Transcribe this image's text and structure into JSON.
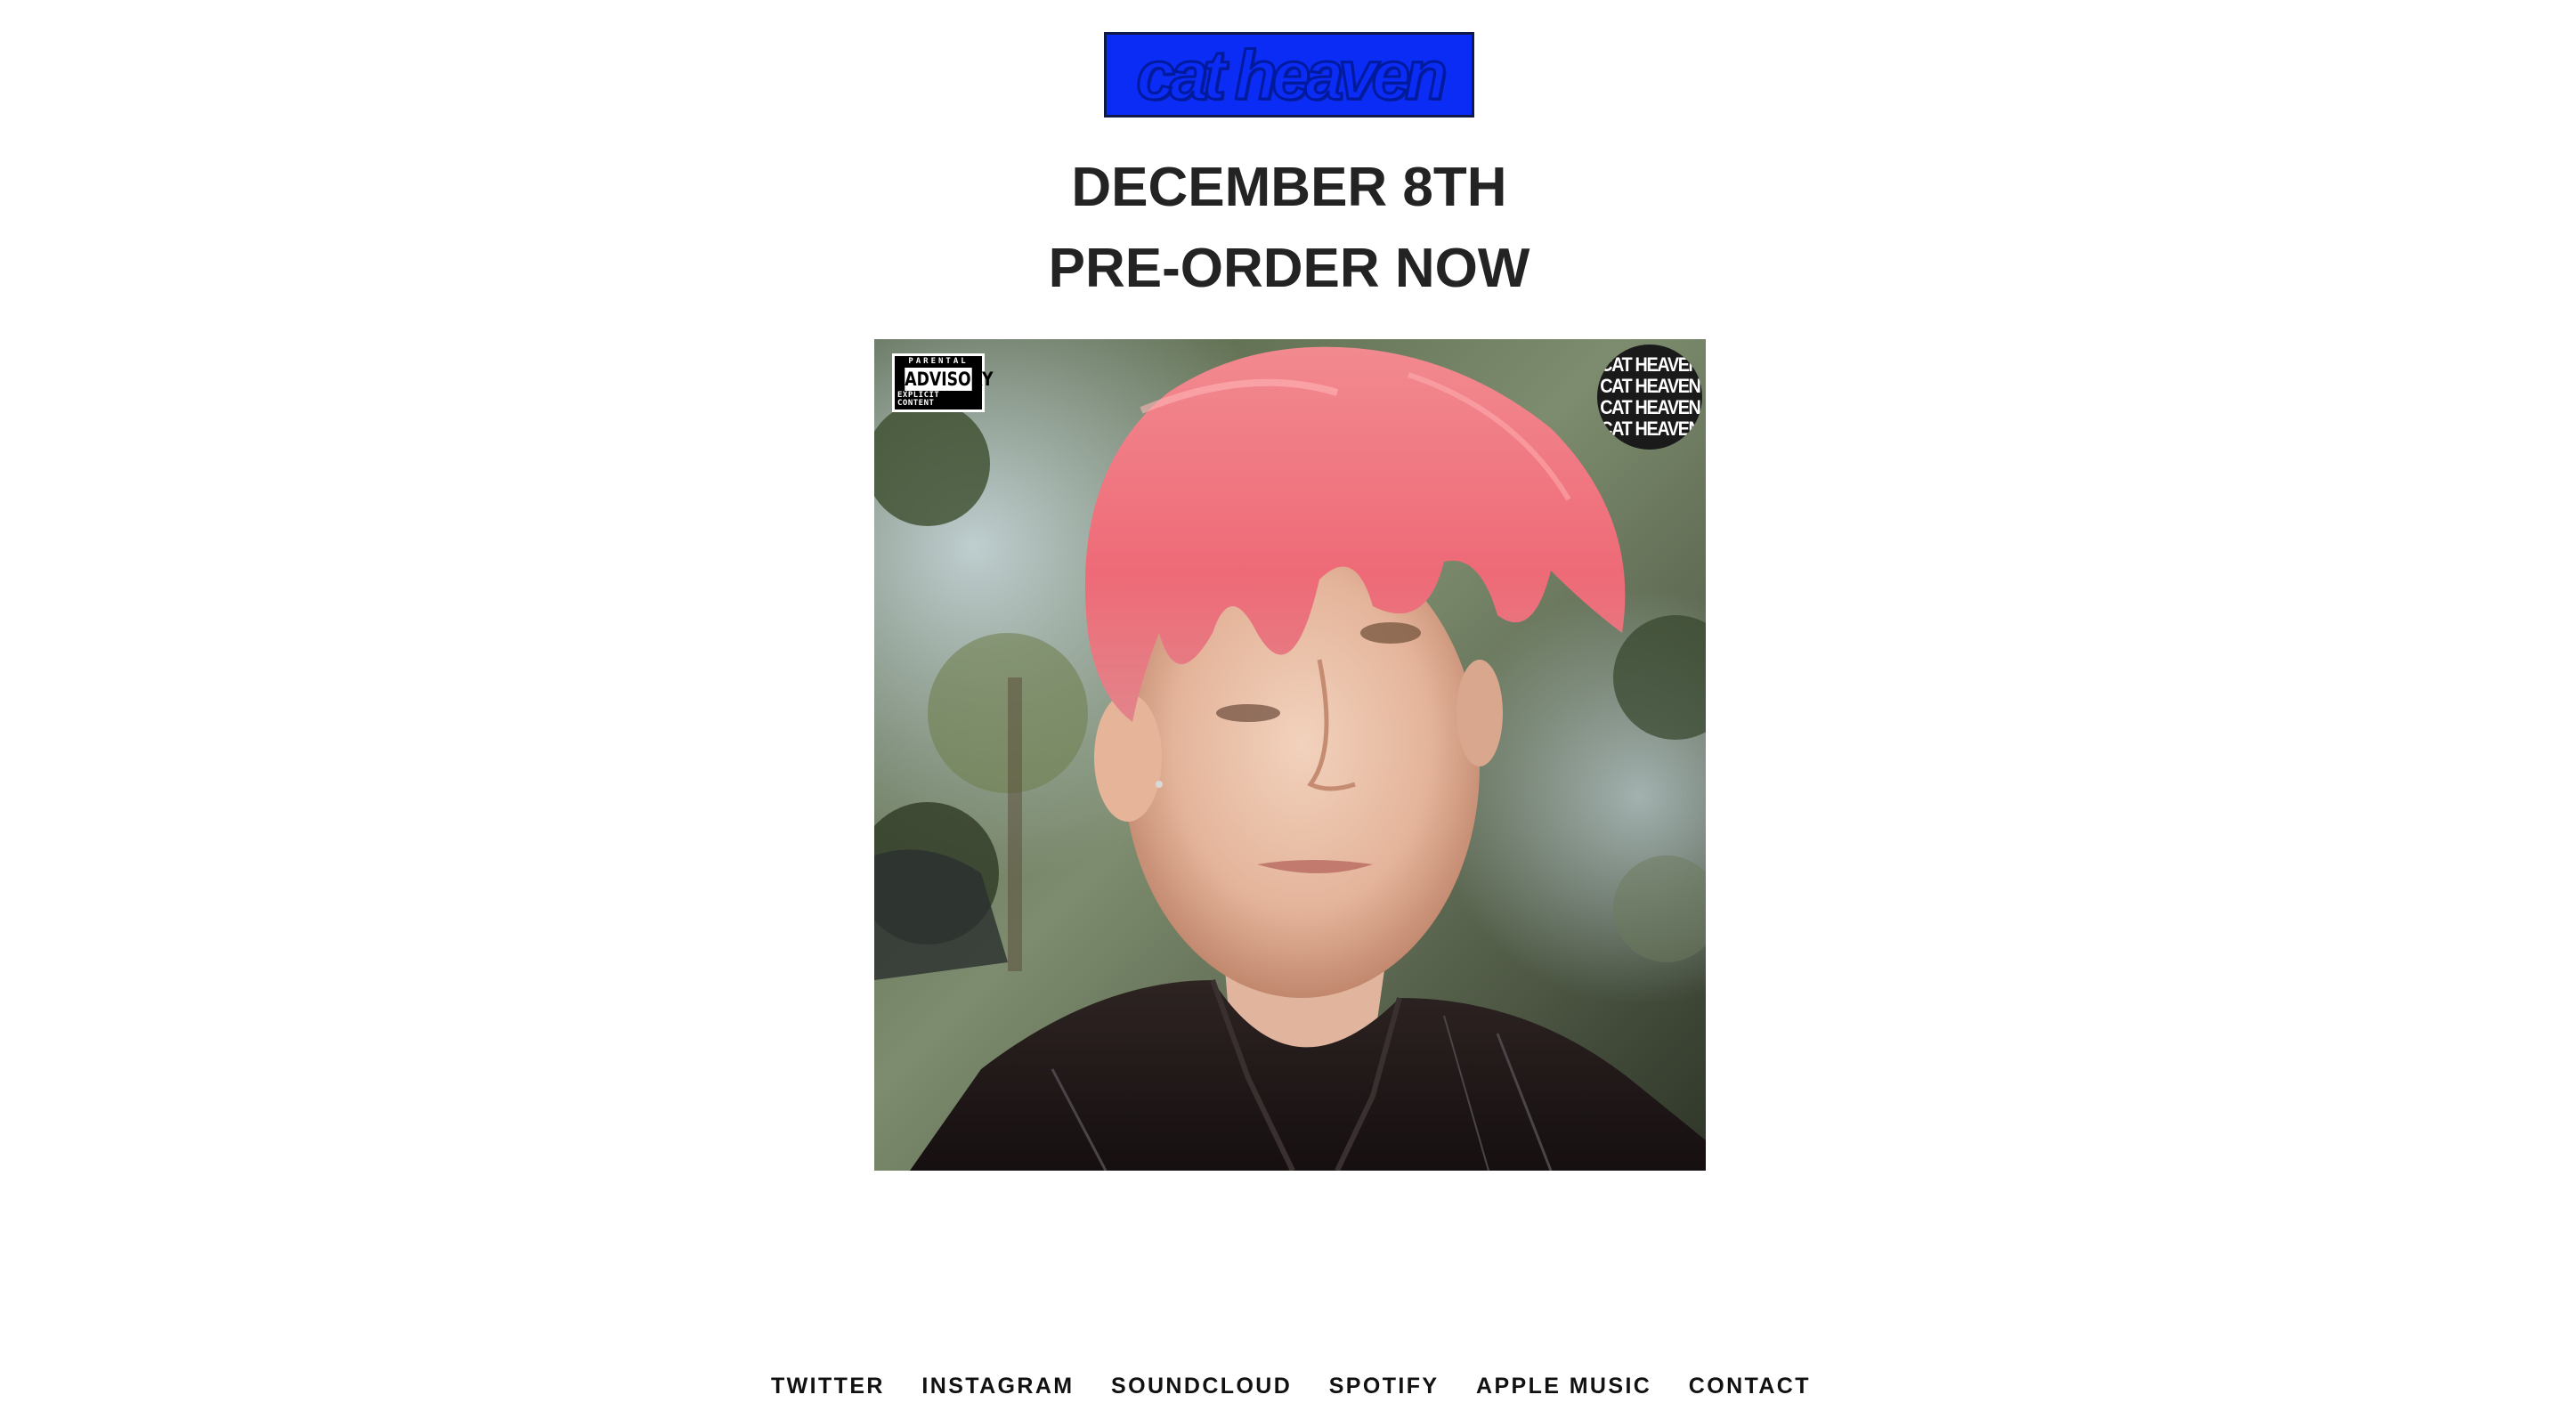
{
  "header": {
    "logo_text": "cat heaven",
    "logo_color": "#0a2cf5"
  },
  "headline": {
    "line1": "DECEMBER 8TH",
    "line2": "PRE-ORDER NOW"
  },
  "album_art": {
    "advisory": {
      "top": "PARENTAL",
      "middle": "ADVISORY",
      "bottom": "EXPLICIT CONTENT"
    },
    "sticker_lines": [
      "CAT HEAVEN",
      "CAT HEAVEN",
      "CAT HEAVEN",
      "CAT HEAVEN"
    ],
    "hair_color": "#f06a78"
  },
  "nav": {
    "links": [
      {
        "label": "TWITTER"
      },
      {
        "label": "INSTAGRAM"
      },
      {
        "label": "SOUNDCLOUD"
      },
      {
        "label": "SPOTIFY"
      },
      {
        "label": "APPLE MUSIC"
      },
      {
        "label": "CONTACT"
      }
    ]
  }
}
